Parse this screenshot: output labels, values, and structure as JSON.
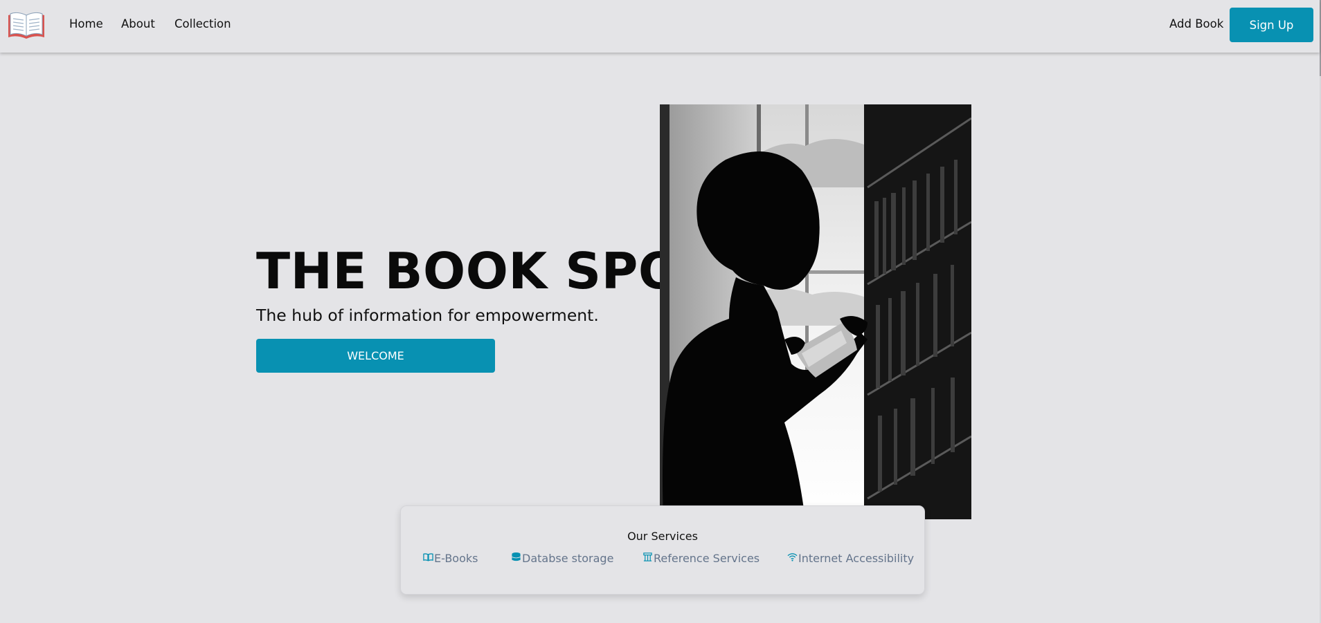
{
  "nav": {
    "logo_icon": "open-book-icon",
    "home": "Home",
    "about": "About",
    "collection": "Collection",
    "add_book": "Add Book",
    "sign_up": "Sign Up"
  },
  "hero": {
    "title": "THE BOOK SPOT",
    "subtitle": "The hub of information for empowerment.",
    "button": "WELCOME",
    "image_subject": "silhouette-reading-in-library"
  },
  "services": {
    "title": "Our Services",
    "items": [
      {
        "label": "E-Books",
        "icon": "open-book-icon"
      },
      {
        "label": "Databse storage",
        "icon": "database-icon"
      },
      {
        "label": "Reference Services",
        "icon": "reference-icon"
      },
      {
        "label": "Internet Accessibility",
        "icon": "wifi-icon"
      }
    ]
  },
  "colors": {
    "background": "#e4e4e7",
    "accent": "#0891b2",
    "service_text": "#64748b"
  }
}
